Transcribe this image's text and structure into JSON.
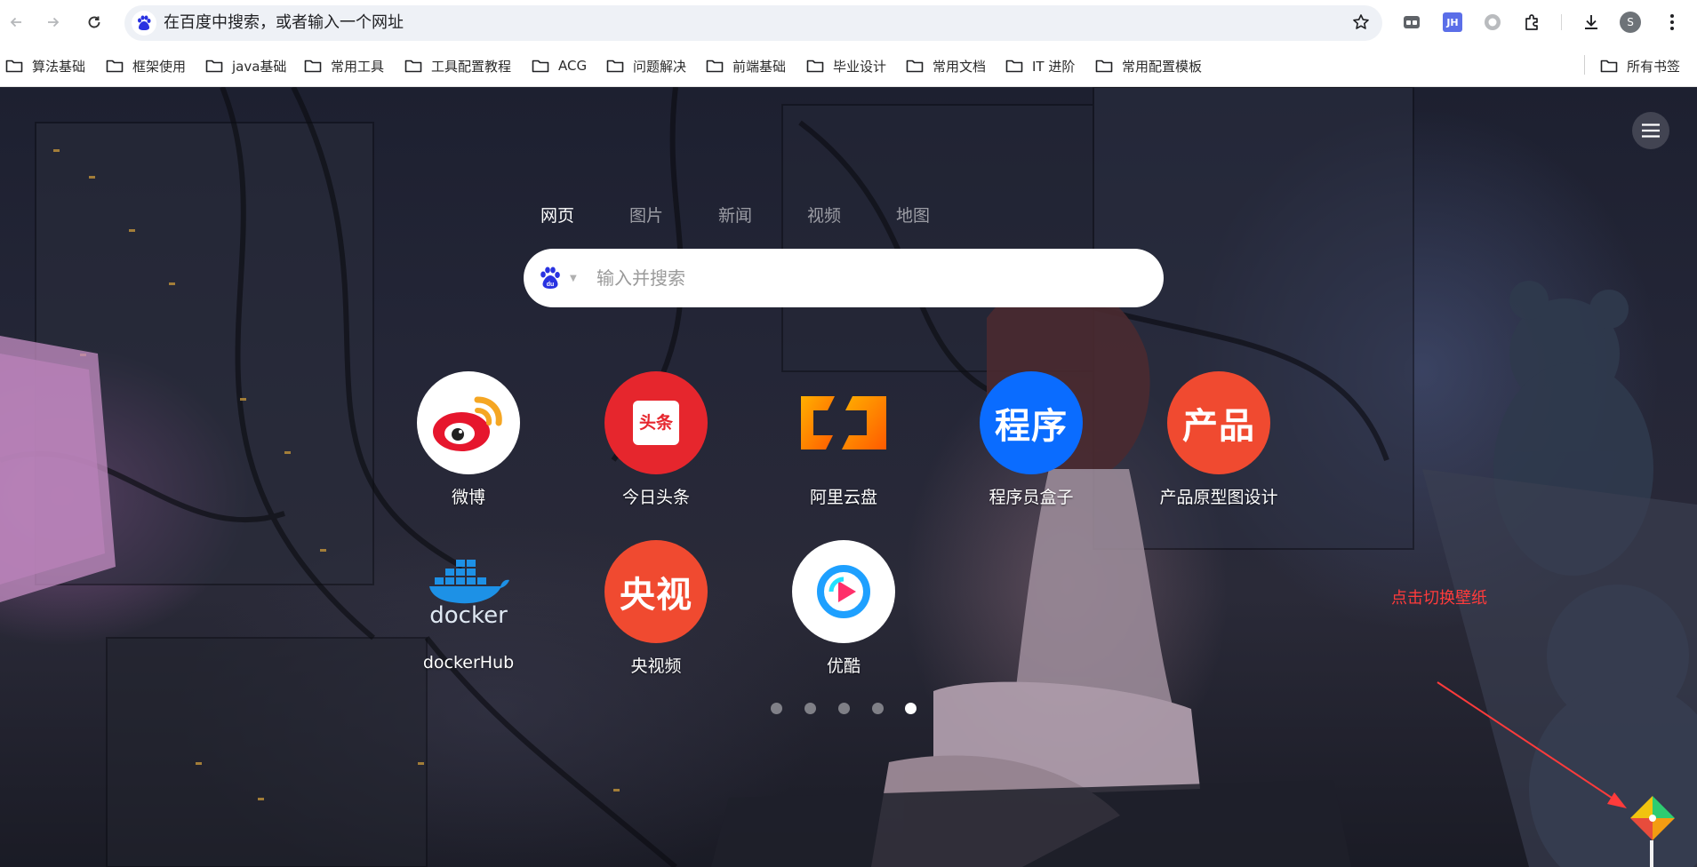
{
  "browser": {
    "omnibox_text": "在百度中搜索，或者输入一个网址",
    "extensions": {
      "jh_label": "JH"
    },
    "profile_initial": "S"
  },
  "bookmarks": {
    "items": [
      {
        "label": "算法基础"
      },
      {
        "label": "框架使用"
      },
      {
        "label": "java基础"
      },
      {
        "label": "常用工具"
      },
      {
        "label": "工具配置教程"
      },
      {
        "label": "ACG"
      },
      {
        "label": "问题解决"
      },
      {
        "label": "前端基础"
      },
      {
        "label": "毕业设计"
      },
      {
        "label": "常用文档"
      },
      {
        "label": "IT 进阶"
      },
      {
        "label": "常用配置模板"
      }
    ],
    "all_bookmarks_label": "所有书签"
  },
  "newtab": {
    "search_tabs": [
      {
        "label": "网页",
        "active": true
      },
      {
        "label": "图片",
        "active": false
      },
      {
        "label": "新闻",
        "active": false
      },
      {
        "label": "视频",
        "active": false
      },
      {
        "label": "地图",
        "active": false
      }
    ],
    "search_placeholder": "输入并搜索",
    "shortcuts": [
      {
        "label": "微博",
        "icon": "weibo-icon"
      },
      {
        "label": "今日头条",
        "icon": "toutiao-icon",
        "icon_text": "头条"
      },
      {
        "label": "阿里云盘",
        "icon": "aliyun-drive-icon"
      },
      {
        "label": "程序员盒子",
        "icon": "text-icon",
        "icon_text": "程序"
      },
      {
        "label": "产品原型图设计",
        "icon": "text-icon",
        "icon_text": "产品"
      },
      {
        "label": "dockerHub",
        "icon": "docker-icon",
        "icon_text": "docker"
      },
      {
        "label": "央视频",
        "icon": "text-icon",
        "icon_text": "央视"
      },
      {
        "label": "优酷",
        "icon": "youku-icon"
      }
    ],
    "pagination": {
      "total": 5,
      "current": 5
    },
    "annotation": "点击切换壁纸"
  },
  "colors": {
    "weibo": "#e6162d",
    "toutiao": "#f04142",
    "aliyun": "#ff6a00",
    "chengxu": "#0a6cff",
    "chanpin": "#f04a30",
    "docker": "#1d91e6",
    "yangshi": "#f04a30",
    "youku": "#1ea0ff",
    "annotation": "#ff3b3b"
  }
}
